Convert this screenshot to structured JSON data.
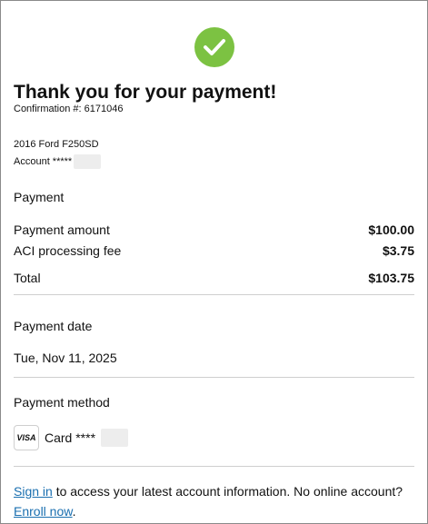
{
  "header": {
    "title": "Thank you for your payment!",
    "confirmation": "Confirmation #: 6171046"
  },
  "vehicle": {
    "name": "2016 Ford F250SD",
    "account_label": "Account *****"
  },
  "payment": {
    "heading": "Payment",
    "rows": [
      {
        "label": "Payment amount",
        "value": "$100.00"
      },
      {
        "label": "ACI processing fee",
        "value": "$3.75"
      }
    ],
    "total_label": "Total",
    "total_value": "$103.75"
  },
  "payment_date": {
    "heading": "Payment date",
    "value": "Tue, Nov 11, 2025"
  },
  "payment_method": {
    "heading": "Payment method",
    "card_brand": "VISA",
    "card_label": "Card ****"
  },
  "footer": {
    "sign_in": "Sign in",
    "text_1": " to access your latest account information. No online account? ",
    "enroll": "Enroll now",
    "text_2": "."
  },
  "colors": {
    "success": "#7cc242",
    "link": "#1a6fb0"
  },
  "icons": [
    "check-icon",
    "visa-icon"
  ]
}
